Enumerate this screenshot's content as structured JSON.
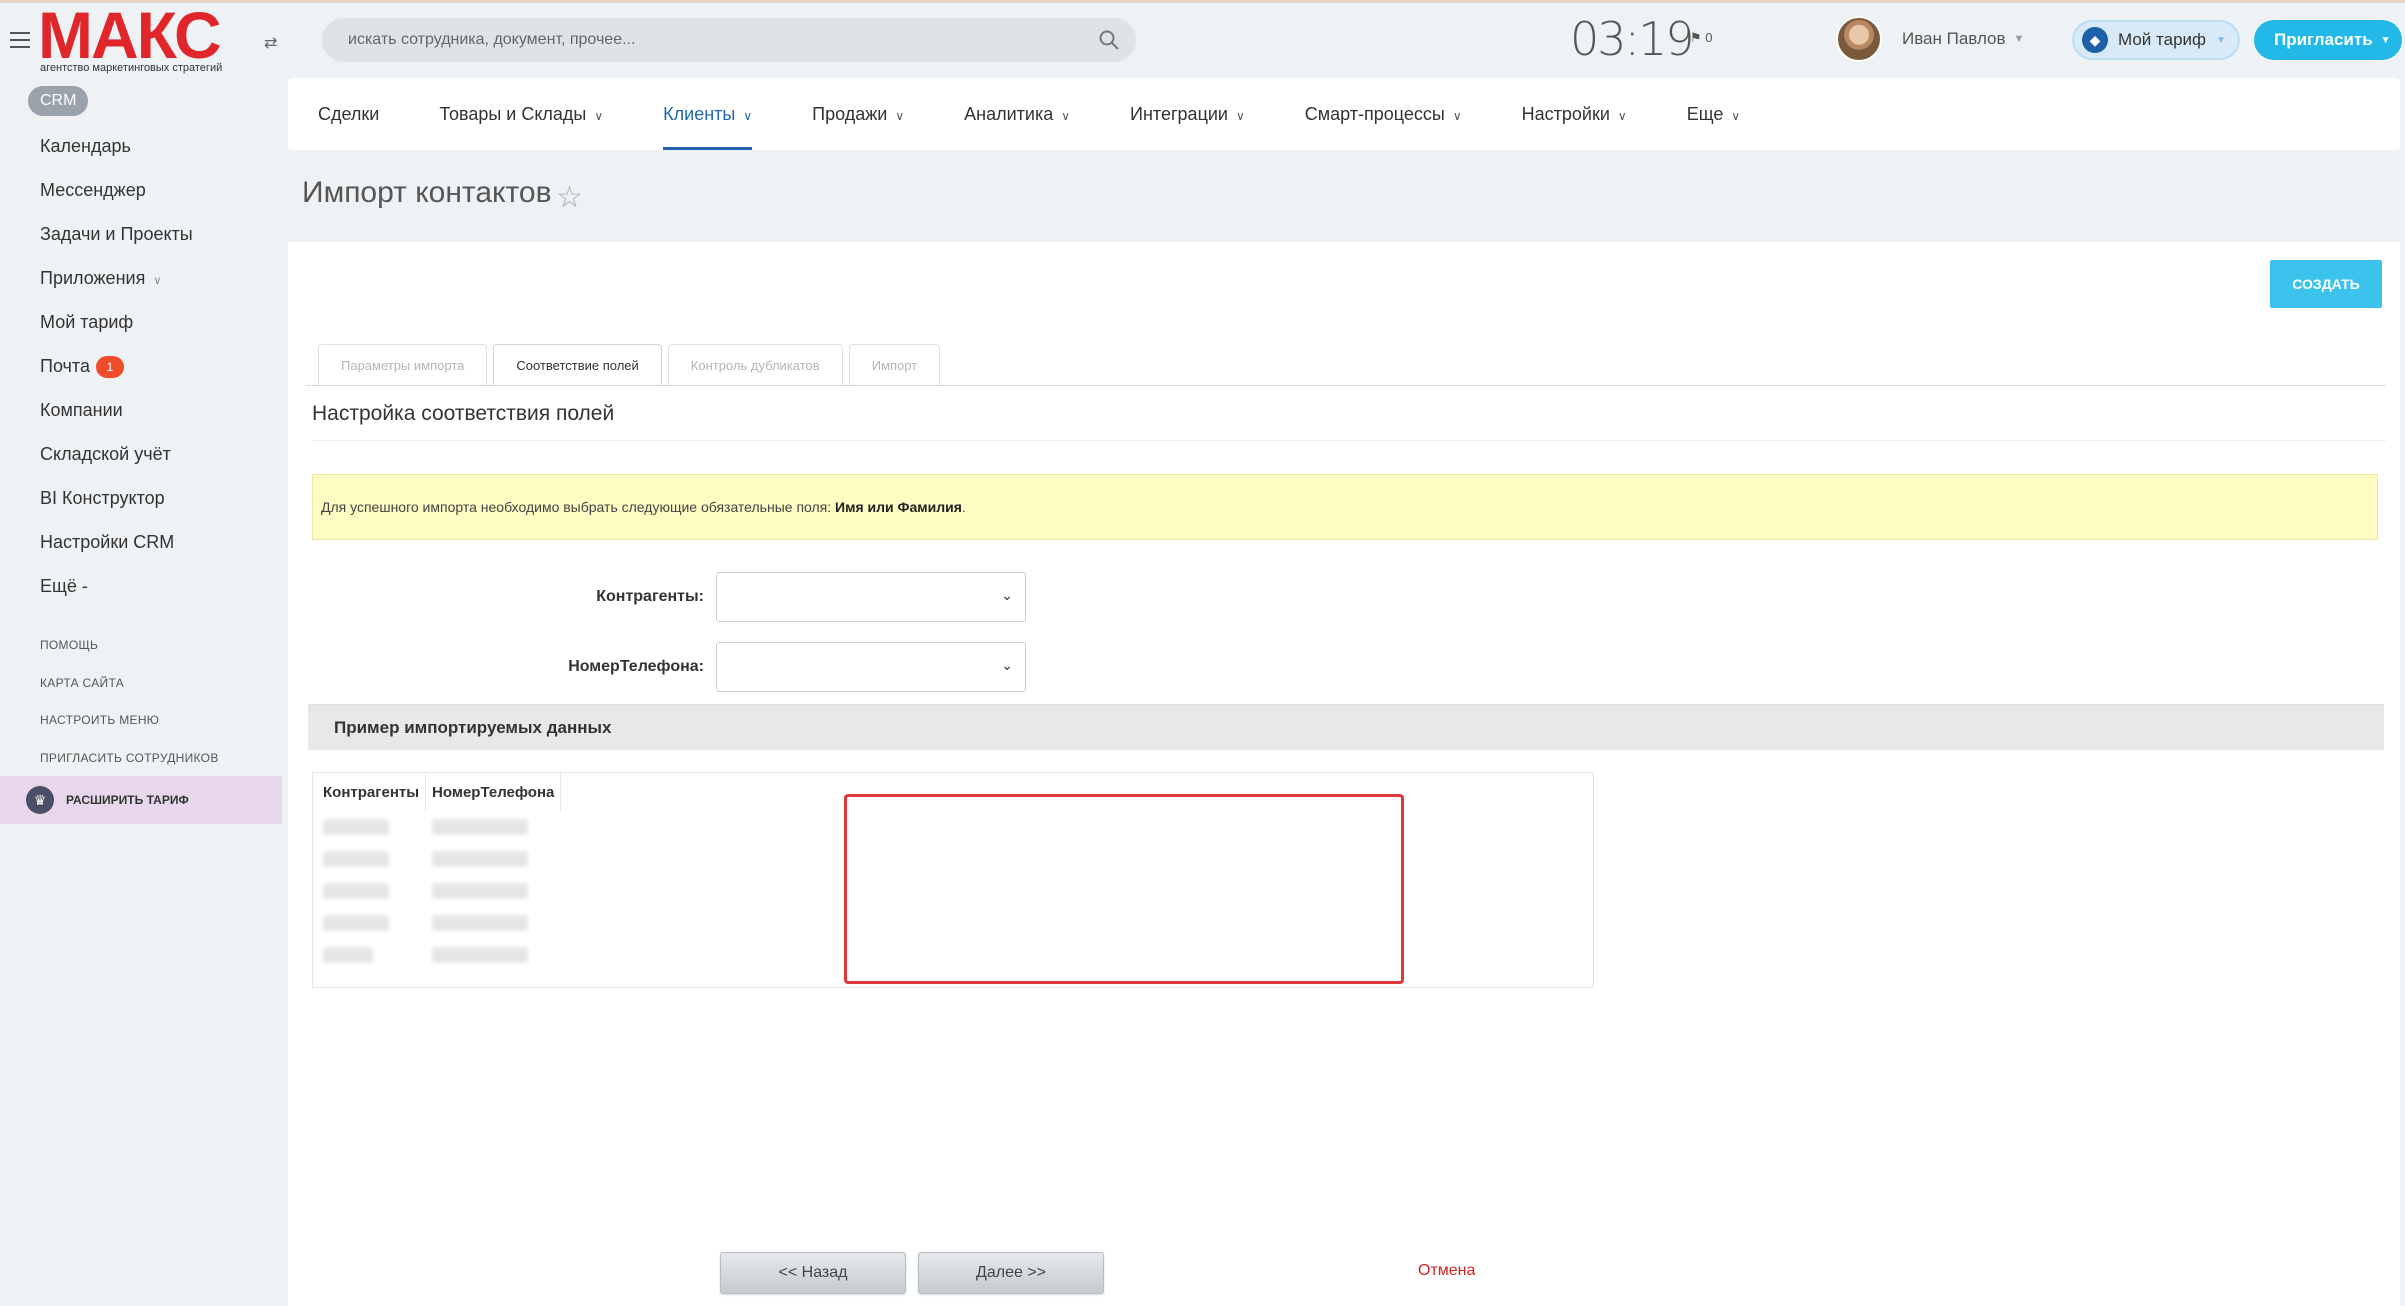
{
  "header": {
    "logo_text": "МАКС",
    "logo_subtitle": "агентство маркетинговых стратегий",
    "search_placeholder": "искать сотрудника, документ, прочее...",
    "clock": "03:19",
    "notifications_count": "0",
    "user_name": "Иван Павлов",
    "tariff_label": "Мой тариф",
    "invite_label": "Пригласить"
  },
  "sidebar": {
    "section_badge": "CRM",
    "items": [
      {
        "label": "Календарь"
      },
      {
        "label": "Мессенджер"
      },
      {
        "label": "Задачи и Проекты"
      },
      {
        "label": "Приложения"
      },
      {
        "label": "Мой тариф"
      },
      {
        "label": "Почта",
        "badge": "1"
      },
      {
        "label": "Компании"
      },
      {
        "label": "Складской учёт"
      },
      {
        "label": "BI Конструктор"
      },
      {
        "label": "Настройки CRM"
      },
      {
        "label": "Ещё -"
      }
    ],
    "small_links": [
      "ПОМОЩЬ",
      "КАРТА САЙТА",
      "НАСТРОИТЬ МЕНЮ",
      "ПРИГЛАСИТЬ СОТРУДНИКОВ"
    ],
    "upgrade_label": "РАСШИРИТЬ ТАРИФ"
  },
  "topnav": {
    "items": [
      "Сделки",
      "Товары и Склады",
      "Клиенты",
      "Продажи",
      "Аналитика",
      "Интеграции",
      "Смарт-процессы",
      "Настройки",
      "Еще"
    ],
    "active": "Клиенты"
  },
  "page": {
    "title": "Импорт контактов",
    "create_button": "СОЗДАТЬ",
    "tabs": [
      "Параметры импорта",
      "Соответствие полей",
      "Контроль дубликатов",
      "Импорт"
    ],
    "active_tab": "Соответствие полей",
    "section_title": "Настройка соответствия полей",
    "notice_text": "Для успешного импорта необходимо выбрать следующие обязательные поля: ",
    "notice_bold": "Имя или Фамилия",
    "notice_end": ".",
    "fields": [
      {
        "label": "Контрагенты:",
        "value": ""
      },
      {
        "label": "НомерТелефона:",
        "value": ""
      }
    ],
    "sample_title": "Пример импортируемых данных",
    "sample_columns": [
      "Контрагенты",
      "НомерТелефона"
    ],
    "back_button": "<< Назад",
    "next_button": "Далее >>",
    "cancel_link": "Отмена"
  },
  "colors": {
    "brand_red": "#e0262b",
    "accent_blue": "#22b9e8",
    "active_nav": "#2066b0",
    "highlight_box": "#e0383a"
  }
}
